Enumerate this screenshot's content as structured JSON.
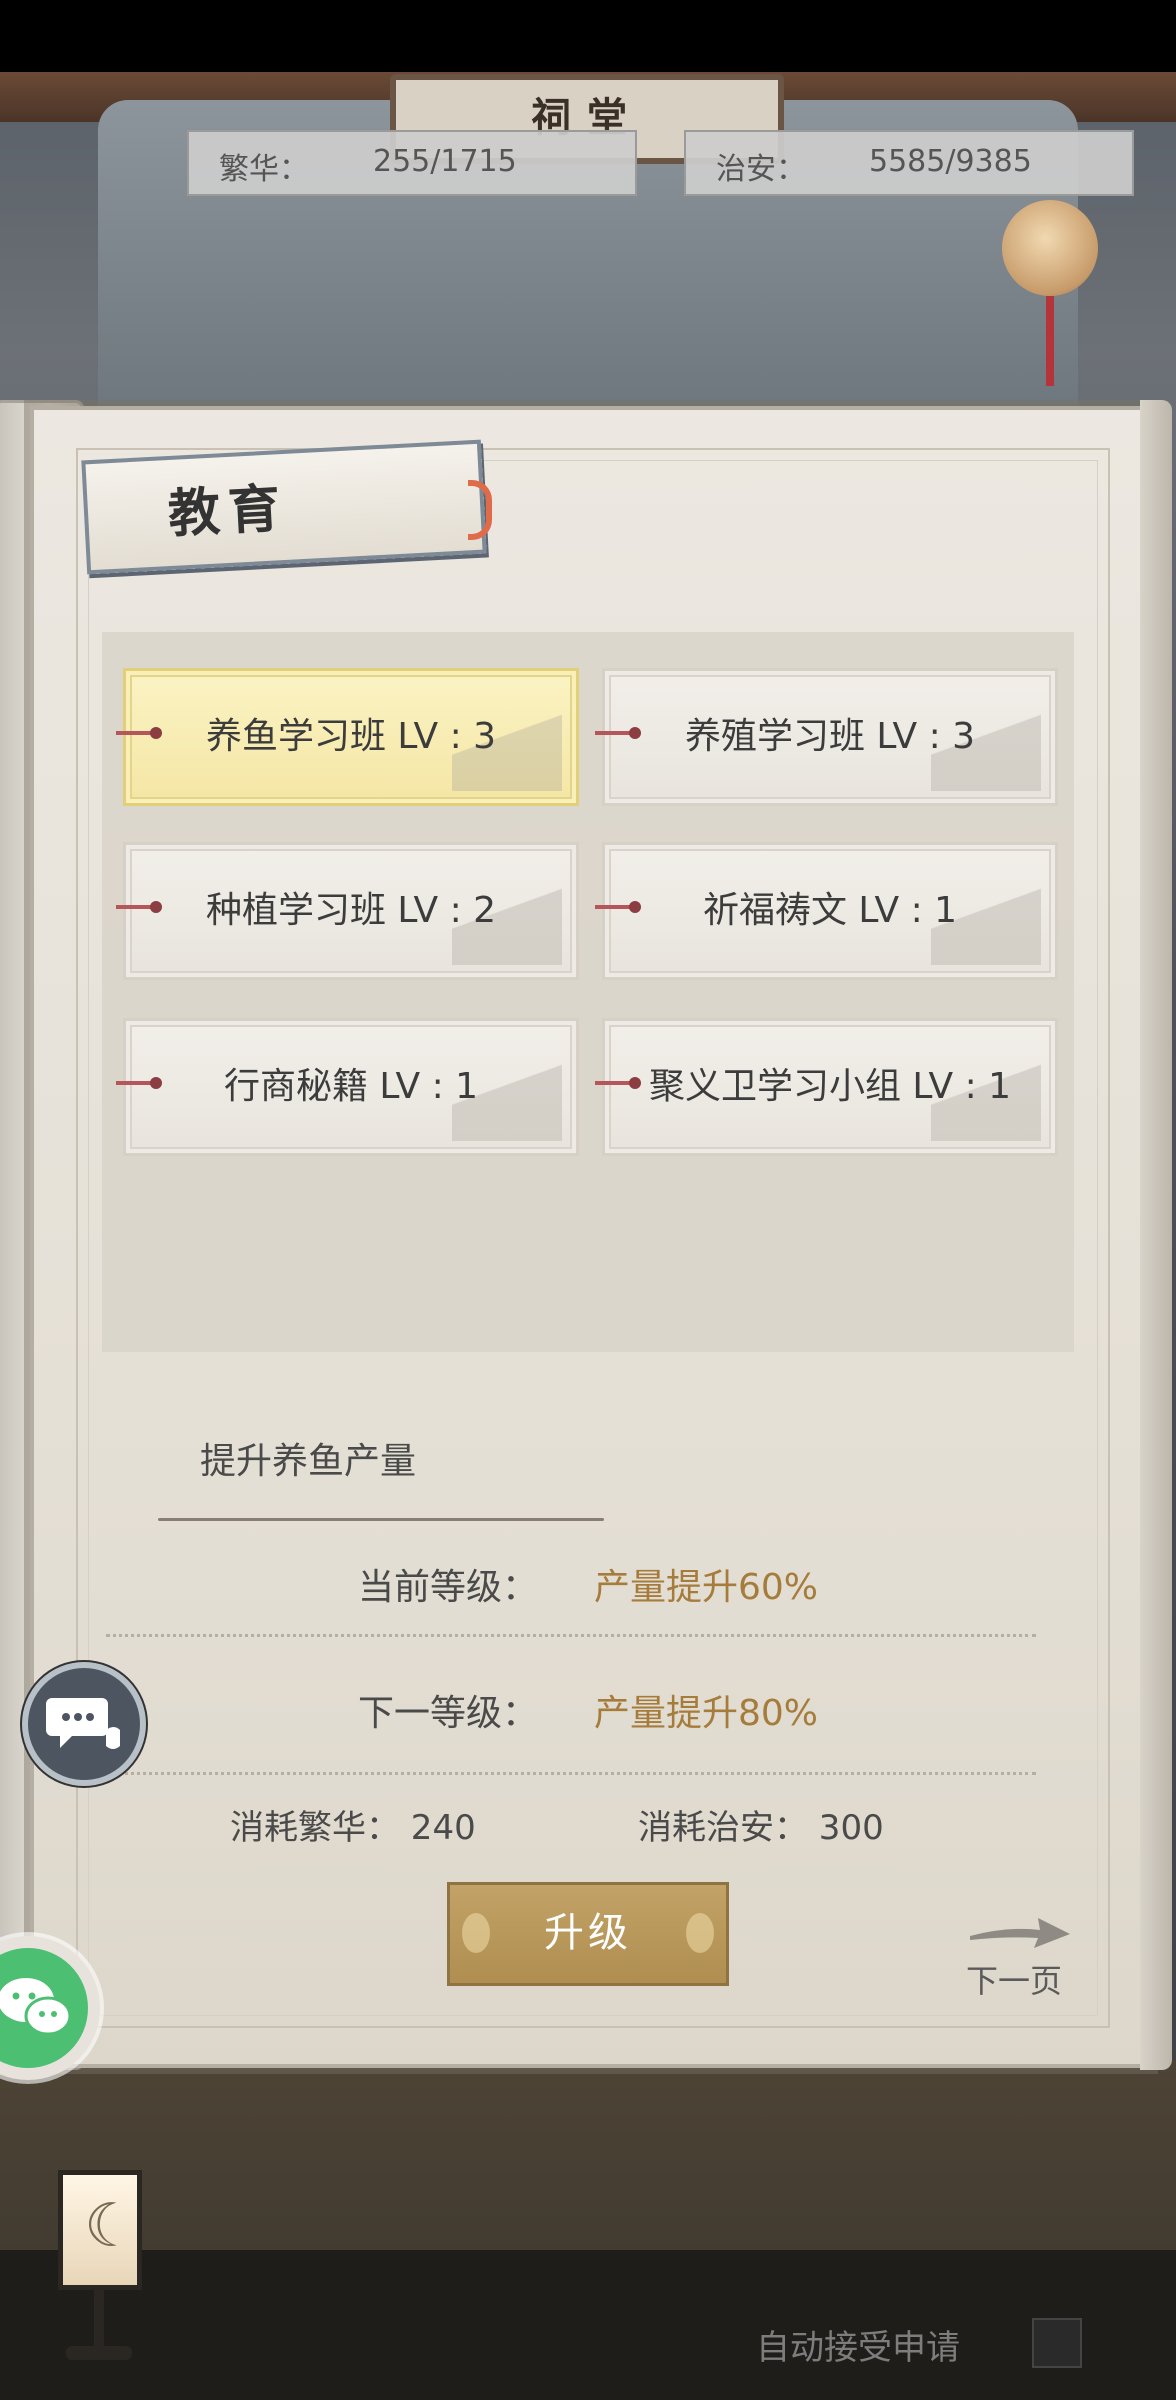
{
  "background": {
    "plaque_text": "祠堂"
  },
  "stats": {
    "prosperity": {
      "label": "繁华：",
      "value": "255/1715"
    },
    "security": {
      "label": "治安：",
      "value": "5585/9385"
    }
  },
  "panel": {
    "title": "教育",
    "items": [
      {
        "label": "养鱼学习班 LV : 3",
        "selected": true
      },
      {
        "label": "养殖学习班 LV : 3",
        "selected": false
      },
      {
        "label": "种植学习班 LV : 2",
        "selected": false
      },
      {
        "label": "祈福祷文 LV : 1",
        "selected": false
      },
      {
        "label": "行商秘籍 LV : 1",
        "selected": false
      },
      {
        "label": "聚义卫学习小组 LV : 1",
        "selected": false
      }
    ],
    "description": {
      "title": "提升养鱼产量",
      "current_label": "当前等级：",
      "current_value": "产量提升60%",
      "next_label": "下一等级：",
      "next_value": "产量提升80%",
      "cost_prosperity": "消耗繁华：  240",
      "cost_security": "消耗治安：  300"
    },
    "upgrade_label": "升级",
    "next_page_label": "下一页"
  },
  "footer": {
    "auto_accept_label": "自动接受申请"
  },
  "colors": {
    "accent_gold": "#a67c3c",
    "button_gold": "#b99a5c",
    "selected_card": "#f7ebb2",
    "wechat_green": "#4cbf73"
  },
  "icons": [
    "chat-bubble-icon",
    "wechat-icon",
    "arrow-right-icon",
    "ribbon-icon",
    "lantern-icon"
  ]
}
